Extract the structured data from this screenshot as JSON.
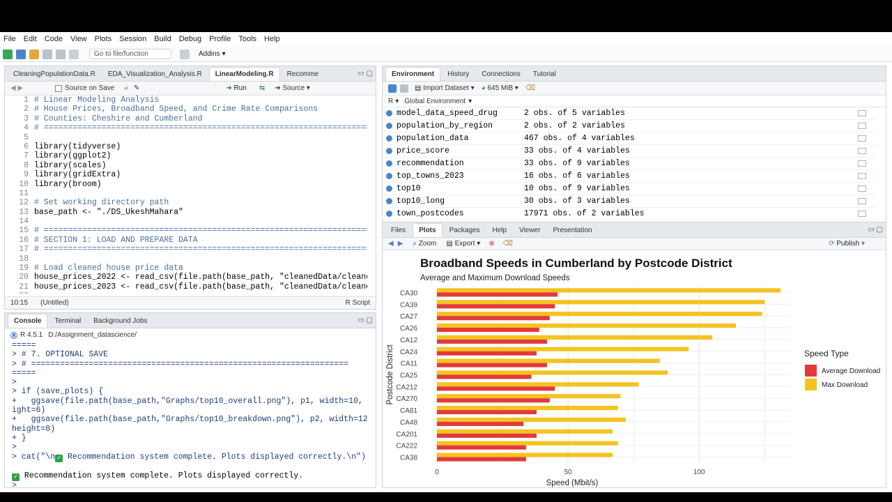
{
  "menu": [
    "File",
    "Edit",
    "Code",
    "View",
    "Plots",
    "Session",
    "Build",
    "Debug",
    "Profile",
    "Tools",
    "Help"
  ],
  "toolbar": {
    "goto_placeholder": "Go to file/function",
    "addins": "Addins"
  },
  "editor": {
    "tabs": [
      "CleaningPopulationData.R",
      "EDA_Visualization_Analysis.R",
      "LinearModeling.R",
      "Recomme"
    ],
    "active_tab": 2,
    "source_on_save": "Source on Save",
    "run": "Run",
    "source": "Source",
    "lines": [
      {
        "n": "1",
        "t": "# Linear Modeling Analysis",
        "k": "cm"
      },
      {
        "n": "2",
        "t": "# House Prices, Broadband Speed, and Crime Rate Comparisons",
        "k": "cm"
      },
      {
        "n": "3",
        "t": "# Counties: Cheshire and Cumberland",
        "k": "cm"
      },
      {
        "n": "4",
        "t": "# ========================================================================",
        "k": "cm"
      },
      {
        "n": "5",
        "t": "",
        "k": ""
      },
      {
        "n": "6",
        "t": "library(tidyverse)",
        "k": ""
      },
      {
        "n": "7",
        "t": "library(ggplot2)",
        "k": ""
      },
      {
        "n": "8",
        "t": "library(scales)",
        "k": ""
      },
      {
        "n": "9",
        "t": "library(gridExtra)",
        "k": ""
      },
      {
        "n": "10",
        "t": "library(broom)",
        "k": ""
      },
      {
        "n": "11",
        "t": "",
        "k": ""
      },
      {
        "n": "12",
        "t": "# Set working directory path",
        "k": "cm"
      },
      {
        "n": "13",
        "t": "base_path <- \"./DS_UkeshMahara\"",
        "k": ""
      },
      {
        "n": "14",
        "t": "",
        "k": ""
      },
      {
        "n": "15",
        "t": "# ========================================================================",
        "k": "cm"
      },
      {
        "n": "16",
        "t": "# SECTION 1: LOAD AND PREPARE DATA",
        "k": "cm"
      },
      {
        "n": "17",
        "t": "# ========================================================================",
        "k": "cm"
      },
      {
        "n": "18",
        "t": "",
        "k": ""
      },
      {
        "n": "19",
        "t": "# Load cleaned house price data",
        "k": "cm"
      },
      {
        "n": "20",
        "t": "house_prices_2022 <- read_csv(file.path(base_path, \"cleanedData/cleane",
        "k": ""
      },
      {
        "n": "21",
        "t": "house_prices_2023 <- read_csv(file.path(base_path, \"cleanedData/cleane",
        "k": ""
      },
      {
        "n": "22",
        "t": "",
        "k": ""
      }
    ],
    "status_pos": "10:15",
    "status_scope": "(Untitled)",
    "status_type": "R Script"
  },
  "console": {
    "tabs": [
      "Console",
      "Terminal",
      "Background Jobs"
    ],
    "r_version": "R 4.5.1",
    "path": "D:/Assignment_datascience/",
    "lines": [
      {
        "t": "=====",
        "k": "in"
      },
      {
        "t": "> # 7. OPTIONAL SAVE",
        "k": "in"
      },
      {
        "t": "> # ==================================================================",
        "k": "in"
      },
      {
        "t": "=====",
        "k": "in"
      },
      {
        "t": ">",
        "k": "in"
      },
      {
        "t": "> if (save_plots) {",
        "k": "in"
      },
      {
        "t": "+   ggsave(file.path(base_path,\"Graphs/top10_overall.png\"), p1, width=10, he",
        "k": "in"
      },
      {
        "t": "ight=6)",
        "k": "in"
      },
      {
        "t": "+   ggsave(file.path(base_path,\"Graphs/top10_breakdown.png\"), p2, width=12,",
        "k": "in"
      },
      {
        "t": "height=8)",
        "k": "in"
      },
      {
        "t": "+ }",
        "k": "in"
      },
      {
        "t": ">",
        "k": "in"
      }
    ],
    "cat_prefix": "> cat(\"\\n",
    "cat_suffix": " Recommendation system complete. Plots displayed correctly.\\n\")",
    "result": " Recommendation system complete. Plots displayed correctly.",
    "prompt": ">"
  },
  "environment": {
    "tabs": [
      "Environment",
      "History",
      "Connections",
      "Tutorial"
    ],
    "import_dataset": "Import Dataset",
    "memory": "645 MiB",
    "lang": "R",
    "scope": "Global Environment",
    "rows": [
      {
        "name": "model_data_speed_drug",
        "value": "2 obs. of 5 variables"
      },
      {
        "name": "population_by_region",
        "value": "2 obs. of 2 variables"
      },
      {
        "name": "population_data",
        "value": "467 obs. of 4 variables"
      },
      {
        "name": "price_score",
        "value": "33 obs. of 4 variables"
      },
      {
        "name": "recommendation",
        "value": "33 obs. of 9 variables"
      },
      {
        "name": "top_towns_2023",
        "value": "16 obs. of 6 variables"
      },
      {
        "name": "top10",
        "value": "10 obs. of 9 variables"
      },
      {
        "name": "top10_long",
        "value": "30 obs. of 3 variables"
      },
      {
        "name": "town_postcodes",
        "value": "17971 obs. of 2 variables"
      }
    ]
  },
  "plots_pane": {
    "tabs": [
      "Files",
      "Plots",
      "Packages",
      "Help",
      "Viewer",
      "Presentation"
    ],
    "zoom": "Zoom",
    "export": "Export",
    "publish": "Publish"
  },
  "chart_data": {
    "type": "bar",
    "orientation": "horizontal",
    "title": "Broadband Speeds in Cumberland by Postcode District",
    "subtitle": "Average and Maximum Download Speeds",
    "xlabel": "Speed (Mbit/s)",
    "ylabel": "Postcode District",
    "xlim": [
      0,
      135
    ],
    "xticks": [
      0,
      50,
      100
    ],
    "grid": true,
    "legend_title": "Speed Type",
    "legend_position": "right",
    "categories": [
      "CA30",
      "CA39",
      "CA27",
      "CA26",
      "CA12",
      "CA24",
      "CA11",
      "CA25",
      "CA212",
      "CA270",
      "CA81",
      "CA48",
      "CA201",
      "CA222",
      "CA38"
    ],
    "series": [
      {
        "name": "Average Download",
        "color": "#e23a3a",
        "values": [
          46,
          45,
          43,
          39,
          42,
          38,
          42,
          36,
          45,
          43,
          38,
          33,
          38,
          34,
          34
        ]
      },
      {
        "name": "Max Download",
        "color": "#f5c321",
        "values": [
          131,
          125,
          124,
          114,
          105,
          96,
          85,
          88,
          77,
          70,
          69,
          72,
          67,
          69,
          67
        ]
      }
    ]
  }
}
